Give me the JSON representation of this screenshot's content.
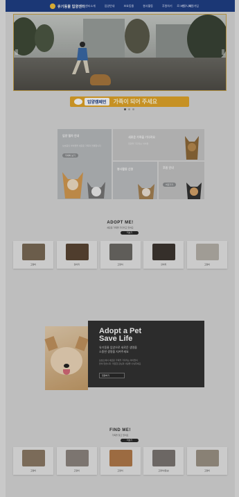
{
  "header": {
    "logo_text": "유기동물 입양센터",
    "nav": [
      "센터소개",
      "입양안내",
      "보호동물",
      "봉사활동",
      "후원하기",
      "커뮤니티"
    ],
    "util": [
      "로그인",
      "회원가입"
    ]
  },
  "banner": {
    "pill": "입양캠페인",
    "message": "가족이 되어 주세요"
  },
  "features": {
    "tile1_title": "입양 절차 안내",
    "tile1_desc": "보호중인 아이들을 새로운 가족과 연결합니다",
    "tile1_button": "자세히 보기",
    "tile2_title": "새로운 가족을 기다려요",
    "tile2_sub": "입양을 기다리는 아이들",
    "tile3_title": "봉사활동 신청",
    "tile4_title": "후원 안내",
    "tile4_button": "바로가기"
  },
  "adopt": {
    "title": "ADOPT ME!",
    "subtitle": "새로운 가족을 기다리고 있어요",
    "button": "더보기",
    "cards": [
      {
        "name": "고양이",
        "color": "#7a6a56"
      },
      {
        "name": "강아지",
        "color": "#5b4634"
      },
      {
        "name": "고양이",
        "color": "#6d6a66"
      },
      {
        "name": "강아지",
        "color": "#3d3630"
      },
      {
        "name": "고양이",
        "color": "#b7b2aa"
      }
    ]
  },
  "promo": {
    "title": "Adopt a Pet\nSave Life",
    "subtitle": "유기동물 입양으로 새로운 생명을\n소중한 생명을 지켜주세요",
    "desc": "보호소에서 새로운 가족을 기다리는 아이들이\n많이 있습니다. 따뜻한 관심과 사랑을 나눠주세요.",
    "button": "입양하기"
  },
  "find": {
    "title": "FIND ME!",
    "subtitle": "가족을 찾고 있어요",
    "button": "더보기",
    "cards": [
      {
        "name": "고양이",
        "color": "#8d7a66"
      },
      {
        "name": "고양이",
        "color": "#8e8680"
      },
      {
        "name": "고양이",
        "color": "#b27a4a"
      },
      {
        "name": "고양이(임보)",
        "color": "#7b7672"
      },
      {
        "name": "고양이",
        "color": "#9d9386"
      }
    ]
  }
}
